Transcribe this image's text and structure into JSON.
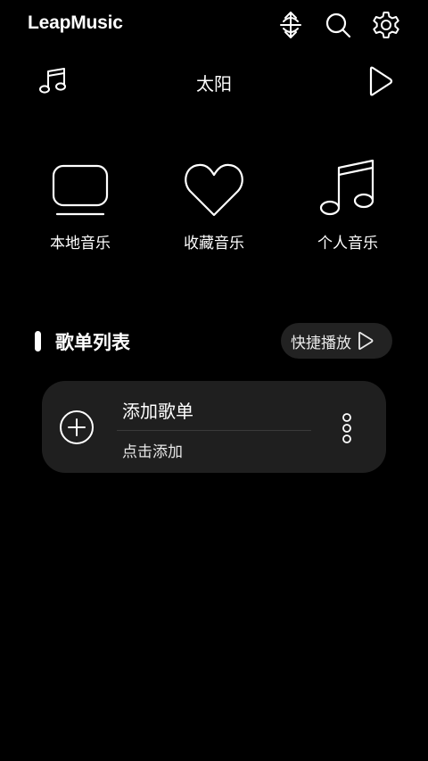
{
  "header": {
    "app_title": "LeapMusic",
    "icons": [
      "sort-icon",
      "search-icon",
      "settings-icon"
    ]
  },
  "player_bar": {
    "note_icon": "music-note-icon",
    "song_title": "太阳",
    "play_icon": "play-icon"
  },
  "categories": [
    {
      "label": "本地音乐",
      "icon": "tv-icon"
    },
    {
      "label": "收藏音乐",
      "icon": "heart-icon"
    },
    {
      "label": "个人音乐",
      "icon": "music-notes-icon"
    }
  ],
  "playlist_section": {
    "title": "歌单列表",
    "quick_play_label": "快捷播放"
  },
  "playlist_card": {
    "title": "添加歌单",
    "subtitle": "点击添加",
    "add_icon": "plus-circle-icon",
    "more_icon": "more-vertical-icon"
  }
}
